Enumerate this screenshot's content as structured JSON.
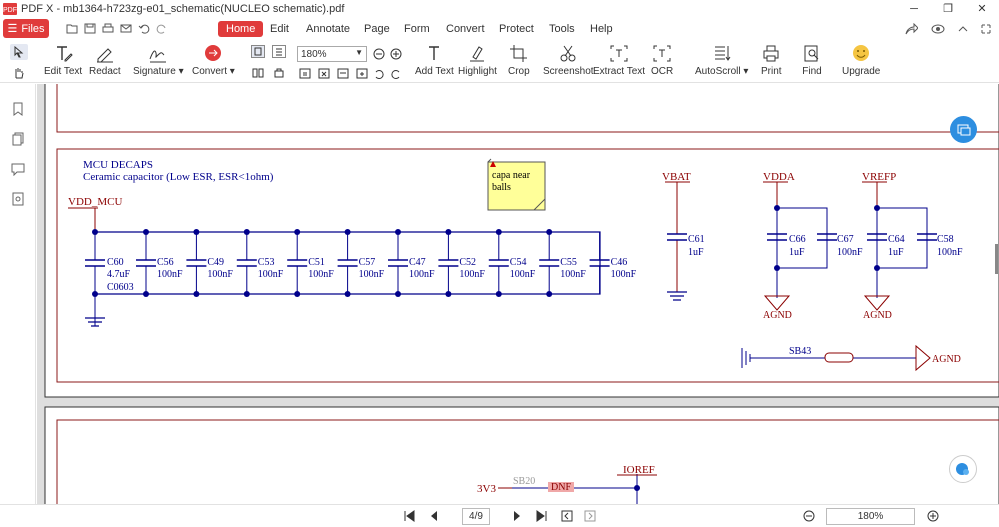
{
  "window": {
    "title": "PDF X - mb1364-h723zg-e01_schematic(NUCLEO schematic).pdf"
  },
  "menubar": {
    "files_label": "Files",
    "items": [
      "Home",
      "Edit",
      "Annotate",
      "Page",
      "Form",
      "Convert",
      "Protect",
      "Tools",
      "Help"
    ],
    "active": "Home"
  },
  "toolbar": {
    "edit_text": "Edit Text",
    "redact": "Redact",
    "signature": "Signature",
    "convert": "Convert",
    "zoom_value": "180%",
    "add_text": "Add Text",
    "highlight": "Highlight",
    "crop": "Crop",
    "screenshot": "Screenshot",
    "extract_text": "Extract Text",
    "ocr": "OCR",
    "autoscroll": "AutoScroll",
    "print": "Print",
    "find": "Find",
    "upgrade": "Upgrade"
  },
  "schematic": {
    "section_title": "MCU DECAPS",
    "section_subtitle": "Ceramic capacitor (Low ESR, ESR<1ohm)",
    "note": {
      "line1": "capa near",
      "line2": "balls"
    },
    "vdd_label": "VDD_MCU",
    "c60": {
      "name": "C60",
      "value": "4.7uF",
      "package": "C0603"
    },
    "caps": [
      {
        "name": "C56",
        "value": "100nF"
      },
      {
        "name": "C49",
        "value": "100nF"
      },
      {
        "name": "C53",
        "value": "100nF"
      },
      {
        "name": "C51",
        "value": "100nF"
      },
      {
        "name": "C57",
        "value": "100nF"
      },
      {
        "name": "C47",
        "value": "100nF"
      },
      {
        "name": "C52",
        "value": "100nF"
      },
      {
        "name": "C54",
        "value": "100nF"
      },
      {
        "name": "C55",
        "value": "100nF"
      },
      {
        "name": "C46",
        "value": "100nF"
      }
    ],
    "vbat": {
      "net": "VBAT",
      "name": "C61",
      "value": "1uF"
    },
    "vdda": {
      "net": "VDDA",
      "cap1": {
        "name": "C66",
        "value": "1uF"
      },
      "cap2": {
        "name": "C67",
        "value": "100nF"
      },
      "gnd": "AGND"
    },
    "vrefp": {
      "net": "VREFP",
      "cap1": {
        "name": "C64",
        "value": "1uF"
      },
      "cap2": {
        "name": "C58",
        "value": "100nF"
      },
      "gnd": "AGND"
    },
    "sb43": {
      "name": "SB43",
      "gnd": "AGND"
    },
    "page2": {
      "net_3v3": "3V3",
      "sb20": "SB20",
      "dnf": "DNF",
      "ioref": "IOREF"
    }
  },
  "bottombar": {
    "page_indicator": "4/9",
    "zoom": "180%"
  },
  "colors": {
    "accent": "#e03b3b",
    "wire": "#00008b",
    "net_label": "#8b0000",
    "frame": "#8b1a1a",
    "note_bg": "#ffff99"
  }
}
